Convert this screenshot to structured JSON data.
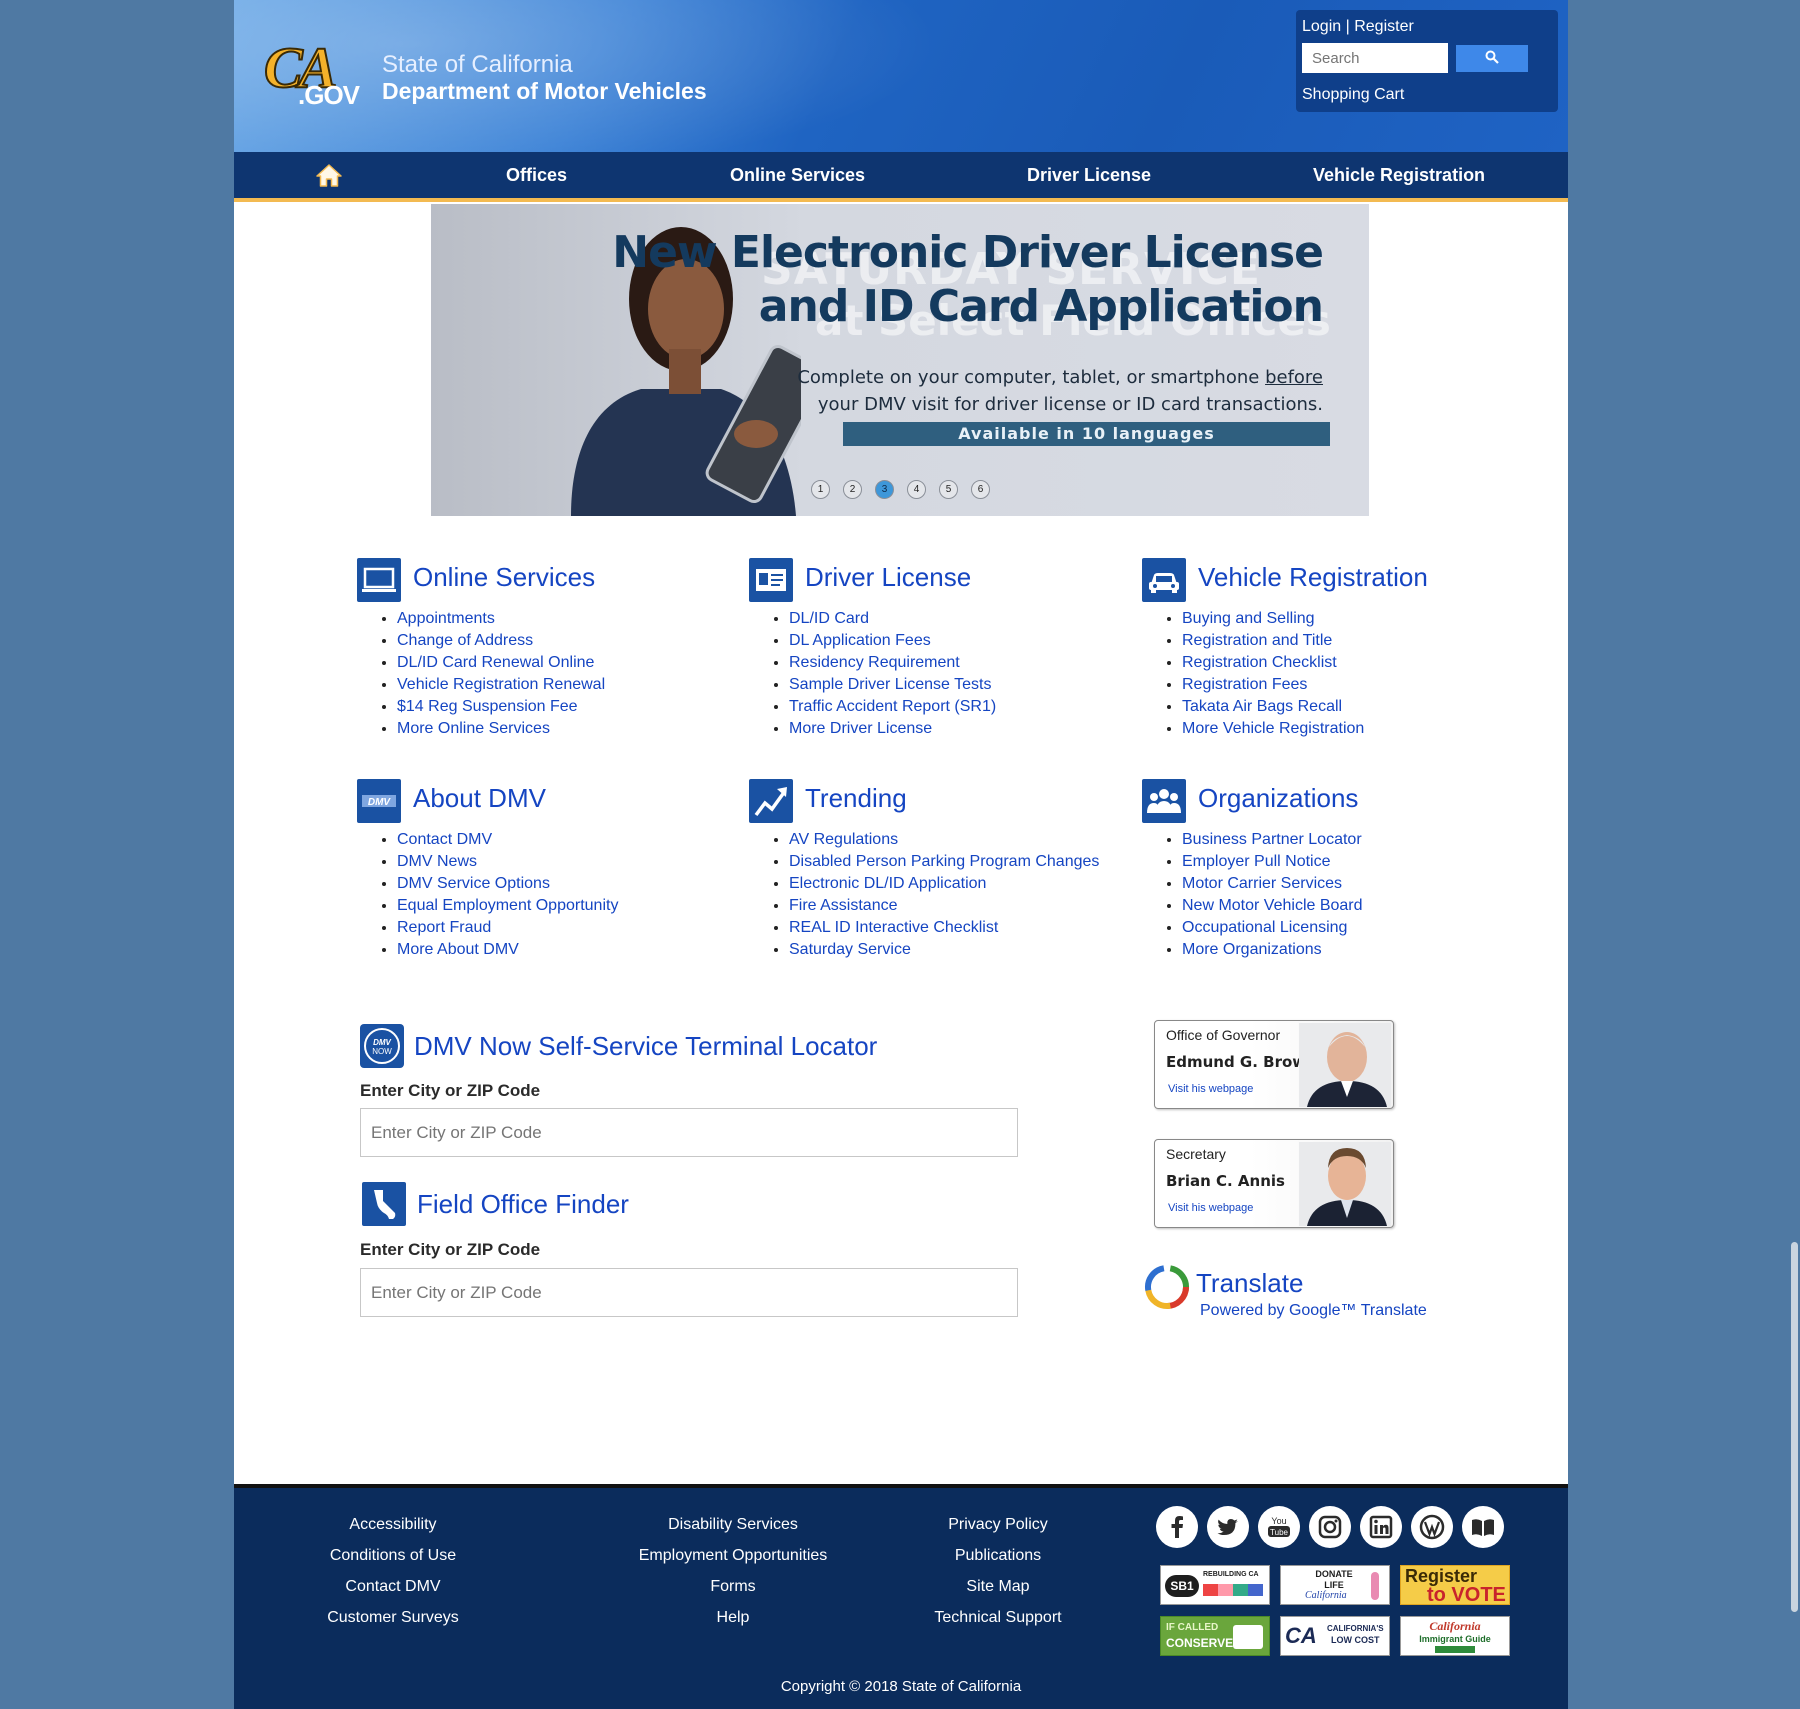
{
  "header": {
    "logo_text_main": "CA",
    "logo_text_suffix": ".GOV",
    "state_line": "State of California",
    "department_line": "Department of Motor Vehicles",
    "login_link": "Login",
    "register_link": "Register",
    "login_separator": "|",
    "search_placeholder": "Search",
    "shopping_cart": "Shopping Cart"
  },
  "nav": {
    "items": [
      "Offices",
      "Online Services",
      "Driver License",
      "Vehicle Registration"
    ]
  },
  "banner": {
    "ghost_line1": "SATURDAY SERVICE",
    "ghost_line2": "at Select Field Offices",
    "title_line1": "New Electronic Driver License",
    "title_line2": "and ID Card Application",
    "subtitle_line1_pre": "Complete on your computer, tablet, or smartphone ",
    "subtitle_line1_em": "before",
    "subtitle_line2": "your DMV visit for driver license or ID card transactions.",
    "pill": "Available in 10 languages",
    "dots": [
      "1",
      "2",
      "3",
      "4",
      "5",
      "6"
    ],
    "active_slide": 3
  },
  "sections": [
    {
      "title": "Online Services",
      "icon": "laptop-icon",
      "links": [
        "Appointments",
        "Change of Address",
        "DL/ID Card Renewal Online",
        "Vehicle Registration Renewal",
        "$14 Reg Suspension Fee",
        "More Online Services"
      ]
    },
    {
      "title": "Driver License",
      "icon": "id-card-icon",
      "links": [
        "DL/ID Card",
        "DL Application Fees",
        "Residency Requirement",
        "Sample Driver License Tests",
        "Traffic Accident Report (SR1)",
        "More Driver License"
      ]
    },
    {
      "title": "Vehicle Registration",
      "icon": "car-icon",
      "links": [
        "Buying and Selling",
        "Registration and Title",
        "Registration Checklist",
        "Registration Fees",
        "Takata Air Bags Recall",
        "More Vehicle Registration"
      ]
    },
    {
      "title": "About DMV",
      "icon": "dmv-logo-icon",
      "links": [
        "Contact DMV",
        "DMV News",
        "DMV Service Options",
        "Equal Employment Opportunity",
        "Report Fraud",
        "More About DMV"
      ]
    },
    {
      "title": "Trending",
      "icon": "trending-chart-icon",
      "links": [
        "AV Regulations",
        "Disabled Person Parking Program Changes",
        "Electronic DL/ID Application",
        "Fire Assistance",
        "REAL ID Interactive Checklist",
        "Saturday Service"
      ]
    },
    {
      "title": "Organizations",
      "icon": "people-group-icon",
      "links": [
        "Business Partner Locator",
        "Employer Pull Notice",
        "Motor Carrier Services",
        "New Motor Vehicle Board",
        "Occupational Licensing",
        "More Organizations"
      ]
    }
  ],
  "dmv_now": {
    "title": "DMV Now Self-Service Terminal Locator",
    "label": "Enter City or ZIP Code",
    "placeholder": "Enter City or ZIP Code",
    "icon_text": "DMV NOW"
  },
  "field_office": {
    "title": "Field Office Finder",
    "label": "Enter City or ZIP Code",
    "placeholder": "Enter City or ZIP Code"
  },
  "governor_card": {
    "role": "Office of Governor",
    "name": "Edmund G. Brown Jr.",
    "link": "Visit his webpage"
  },
  "secretary_card": {
    "role": "Secretary",
    "name": "Brian C. Annis",
    "link": "Visit his webpage"
  },
  "translate": {
    "title": "Translate",
    "subtitle": "Powered by Google™ Translate"
  },
  "footer": {
    "col1": [
      "Accessibility",
      "Conditions of Use",
      "Contact DMV",
      "Customer Surveys"
    ],
    "col2": [
      "Disability Services",
      "Employment Opportunities",
      "Forms",
      "Help"
    ],
    "col3": [
      "Privacy Policy",
      "Publications",
      "Site Map",
      "Technical Support"
    ],
    "social_icons": [
      "facebook-icon",
      "twitter-icon",
      "youtube-icon",
      "instagram-icon",
      "linkedin-icon",
      "wordpress-icon",
      "book-icon"
    ],
    "badges": [
      {
        "name": "sb1-rebuilding-ca-badge",
        "text": "SB1",
        "sub": "REBUILDING CA"
      },
      {
        "name": "donate-life-badge",
        "text": "DONATE LIFE",
        "sub": "California"
      },
      {
        "name": "register-to-vote-badge",
        "text": "Register",
        "sub": "to VOTE"
      },
      {
        "name": "if-called-conserve-badge",
        "text": "IF CALLED",
        "sub": "CONSERVE"
      },
      {
        "name": "low-cost-auto-insurance-badge",
        "text": "CALIFORNIA'S",
        "sub": "LOW COST"
      },
      {
        "name": "immigrant-guide-badge",
        "text": "California",
        "sub": "Immigrant Guide"
      }
    ],
    "copyright": "Copyright © 2018 State of California"
  },
  "colors": {
    "page_bg": "#4f79a3",
    "nav_bg": "#0e3570",
    "nav_underline": "#f3ba51",
    "link": "#1545c2",
    "footer_bg": "#0b2c5c",
    "search_button": "#3e88e9"
  }
}
